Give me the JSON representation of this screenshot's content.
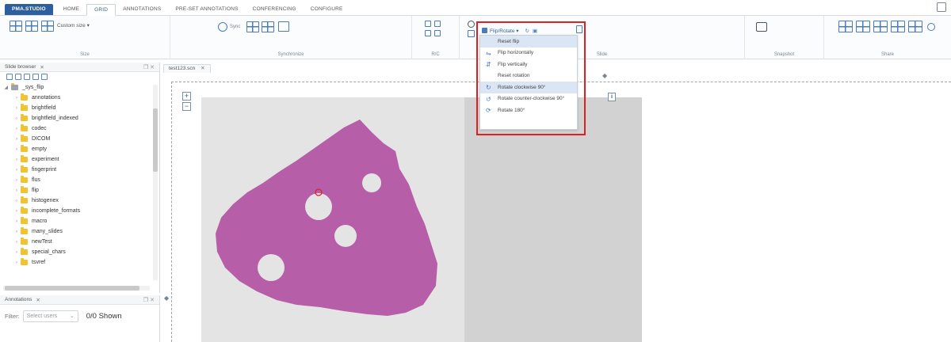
{
  "tabs": [
    {
      "label": "PMA.STUDIO",
      "kind": "brand"
    },
    {
      "label": "HOME",
      "kind": "normal"
    },
    {
      "label": "GRID",
      "kind": "active"
    },
    {
      "label": "ANNOTATIONS",
      "kind": "normal"
    },
    {
      "label": "PRE-SET ANNOTATIONS",
      "kind": "normal"
    },
    {
      "label": "CONFERENCING",
      "kind": "normal"
    },
    {
      "label": "CONFIGURE",
      "kind": "normal"
    }
  ],
  "ribbon": {
    "custom_size": "Custom size ▾",
    "groups": {
      "size": "Size",
      "synchronize": "Synchronize",
      "rc": "R/C",
      "slide": "Slide",
      "snapshot": "Snapshot",
      "share": "Share"
    },
    "sync_label": "Sync",
    "flip_rotate": "Flip/Rotate ▾"
  },
  "dropdown": {
    "items": [
      {
        "label": "Reset flip",
        "icon": "",
        "highlight": true
      },
      {
        "label": "Flip horizontally",
        "icon": "⇋",
        "highlight": false
      },
      {
        "label": "Flip vertically",
        "icon": "⇵",
        "highlight": false
      },
      {
        "label": "Reset rotation",
        "icon": "",
        "highlight": false
      },
      {
        "label": "Rotate clockwise 90°",
        "icon": "↻",
        "highlight": true
      },
      {
        "label": "Rotate counter-clockwise 90°",
        "icon": "↺",
        "highlight": false
      },
      {
        "label": "Rotate 180°",
        "icon": "⟳",
        "highlight": false
      }
    ]
  },
  "slide_browser": {
    "title": "Slide browser",
    "root": "_sys_flip",
    "folders": [
      "annotations",
      "brightfield",
      "brightfield_indexed",
      "codec",
      "DICOM",
      "empty",
      "experiment",
      "fingerprint",
      "flus",
      "flip",
      "histogenex",
      "incomplete_formats",
      "macro",
      "many_slides",
      "newTest",
      "special_chars",
      "tsvref"
    ]
  },
  "annotations_panel": {
    "title": "Annotations",
    "filter_label": "Filter:",
    "select_placeholder": "Select users",
    "shown": "0/0 Shown"
  },
  "viewer": {
    "tab_label": "test123.scn"
  },
  "colors": {
    "brand": "#2d5f9e",
    "highlight_box": "#e02020",
    "tissue": "#b04fa0"
  }
}
